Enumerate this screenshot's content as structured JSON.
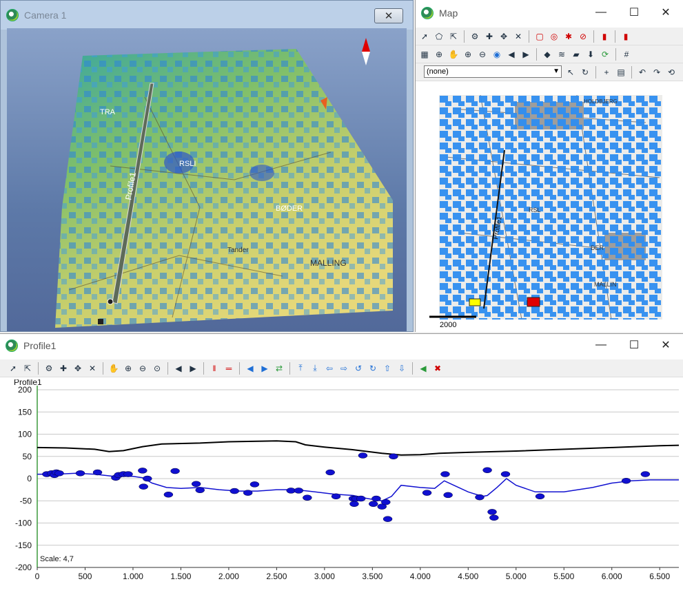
{
  "camera": {
    "title": "Camera 1",
    "close_symbol": "✕",
    "compass_colors": {
      "north": "#e00000",
      "south": "#ffffff"
    },
    "map_labels": [
      "TRA",
      "RSLI",
      "BØDER",
      "Tander",
      "MALLING",
      "Profile1"
    ]
  },
  "map": {
    "title": "Map",
    "layer_value": "(none)",
    "scale_text": "2000",
    "profile_label": "Profile1",
    "map_labels": [
      "HOLDBJERG",
      "RSL",
      "DER",
      "MALLIN"
    ],
    "toolbar_rows": [
      [
        "select-arrow-icon",
        "polygon-select-icon",
        "text-select-icon",
        "sep",
        "node-tool-icon",
        "node-add-icon",
        "node-move-icon",
        "delete-icon",
        "sep",
        "rectangle-red-icon",
        "circle-target-icon",
        "star-icon",
        "no-entry-icon",
        "sep",
        "red-bar-icon",
        "sep",
        "red-marker-icon"
      ],
      [
        "grid-icon",
        "zoom-area-icon",
        "pan-hand-icon",
        "zoom-in-icon",
        "zoom-out-icon",
        "globe-icon",
        "back-icon",
        "forward-icon",
        "sep",
        "layers-color-icon",
        "layer-stack-icon",
        "folder-icon",
        "download-icon",
        "refresh-icon",
        "sep",
        "hash-grid-icon"
      ],
      [
        "cursor-icon",
        "rotate-icon",
        "sep",
        "plus-icon",
        "table-icon",
        "sep",
        "undo-icon",
        "redo-icon",
        "reset-icon"
      ]
    ]
  },
  "profile": {
    "title": "Profile1",
    "scale_label": "Scale: 4,7",
    "toolbar": [
      "select-arrow-icon",
      "text-select-icon",
      "sep",
      "node-tool-icon",
      "node-add-icon",
      "node-move-icon",
      "delete-icon",
      "sep",
      "pan-hand-icon",
      "zoom-in-icon",
      "zoom-out-icon",
      "zoom-reset-icon",
      "sep",
      "back-icon",
      "forward-icon",
      "sep",
      "vertical-bars-icon",
      "horizontal-bars-icon",
      "sep",
      "triangle-left-icon",
      "triangle-right-icon",
      "swap-icon",
      "sep",
      "move-top-icon",
      "move-bottom-icon",
      "arrow-left-icon",
      "arrow-right-icon",
      "rotate-left-icon",
      "rotate-right-icon",
      "arrow-up-icon",
      "arrow-down-icon",
      "sep",
      "speaker-icon",
      "speaker-mute-icon"
    ]
  },
  "window_controls": {
    "minimize": "—",
    "maximize": "☐",
    "close": "✕"
  },
  "chart_data": {
    "type": "line",
    "title": "Profile1",
    "xlabel": "",
    "ylabel": "",
    "xlim": [
      0,
      6700
    ],
    "ylim": [
      -200,
      200
    ],
    "x_ticks": [
      0,
      500,
      1000,
      1500,
      2000,
      2500,
      3000,
      3500,
      4000,
      4500,
      5000,
      5500,
      6000,
      6500
    ],
    "x_tick_labels": [
      "0",
      "500",
      "1.000",
      "1.500",
      "2.000",
      "2.500",
      "3.000",
      "3.500",
      "4.000",
      "4.500",
      "5.000",
      "5.500",
      "6.000",
      "6.500"
    ],
    "y_ticks": [
      200,
      150,
      100,
      50,
      0,
      -50,
      -100,
      -150,
      -200
    ],
    "grid": true,
    "series": [
      {
        "color": "#000000",
        "x": [
          0,
          300,
          600,
          750,
          900,
          1100,
          1300,
          1700,
          2000,
          2300,
          2500,
          2700,
          2800,
          3000,
          3300,
          3600,
          3800,
          4000,
          4200,
          4500,
          5000,
          5500,
          6000,
          6500,
          6700
        ],
        "y": [
          70,
          69,
          66,
          61,
          63,
          72,
          78,
          80,
          83,
          84,
          85,
          83,
          76,
          71,
          65,
          57,
          53,
          54,
          57,
          59,
          62,
          66,
          70,
          74,
          75
        ]
      },
      {
        "color": "#1010d0",
        "x": [
          0,
          200,
          400,
          600,
          800,
          1000,
          1100,
          1200,
          1350,
          1500,
          1700,
          1900,
          2100,
          2300,
          2500,
          2700,
          2900,
          3100,
          3300,
          3450,
          3600,
          3700,
          3800,
          4000,
          4150,
          4250,
          4350,
          4500,
          4650,
          4700,
          4800,
          4900,
          5000,
          5200,
          5500,
          5800,
          6000,
          6200,
          6400,
          6700
        ],
        "y": [
          10,
          10,
          12,
          10,
          5,
          5,
          2,
          -10,
          -20,
          -22,
          -20,
          -25,
          -28,
          -28,
          -25,
          -25,
          -30,
          -35,
          -38,
          -45,
          -50,
          -40,
          -15,
          -20,
          -22,
          -5,
          -15,
          -30,
          -40,
          -38,
          -20,
          0,
          -15,
          -30,
          -30,
          -20,
          -10,
          -5,
          -3,
          -3
        ]
      },
      {
        "type": "scatter",
        "color": "#1010d0",
        "x": [
          100,
          150,
          180,
          200,
          230,
          450,
          630,
          820,
          850,
          900,
          950,
          1100,
          1110,
          1150,
          1370,
          1440,
          1660,
          1700,
          2060,
          2200,
          2270,
          2650,
          2730,
          2820,
          3060,
          3120,
          3300,
          3310,
          3330,
          3380,
          3400,
          3510,
          3540,
          3600,
          3640,
          3660,
          3720,
          4070,
          4260,
          4290,
          4620,
          4700,
          4750,
          4770,
          4890,
          5250,
          6150,
          6350
        ],
        "y": [
          10,
          12,
          8,
          14,
          12,
          12,
          14,
          2,
          8,
          10,
          10,
          18,
          -18,
          0,
          -36,
          17,
          -12,
          -26,
          -28,
          -32,
          -13,
          -27,
          -27,
          -43,
          14,
          -40,
          -45,
          -57,
          -45,
          -45,
          52,
          -57,
          -45,
          -63,
          -53,
          -91,
          50,
          -32,
          10,
          -37,
          -42,
          19,
          -75,
          -88,
          10,
          -40,
          -5,
          10
        ]
      }
    ]
  }
}
